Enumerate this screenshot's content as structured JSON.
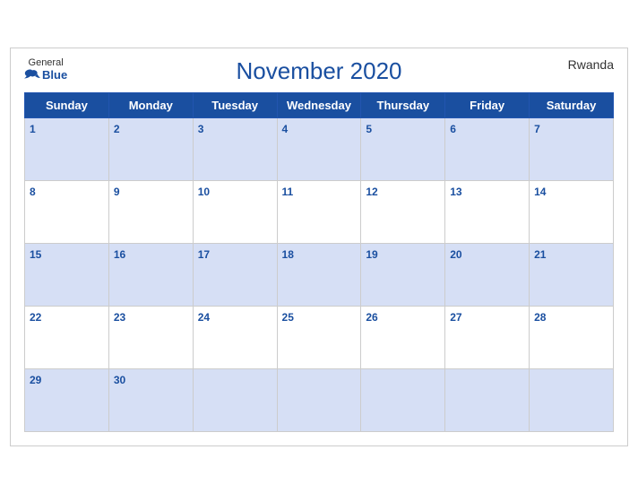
{
  "header": {
    "logo": {
      "general": "General",
      "blue": "Blue"
    },
    "title": "November 2020",
    "country": "Rwanda"
  },
  "weekdays": [
    "Sunday",
    "Monday",
    "Tuesday",
    "Wednesday",
    "Thursday",
    "Friday",
    "Saturday"
  ],
  "weeks": [
    [
      {
        "date": "1",
        "empty": false
      },
      {
        "date": "2",
        "empty": false
      },
      {
        "date": "3",
        "empty": false
      },
      {
        "date": "4",
        "empty": false
      },
      {
        "date": "5",
        "empty": false
      },
      {
        "date": "6",
        "empty": false
      },
      {
        "date": "7",
        "empty": false
      }
    ],
    [
      {
        "date": "8",
        "empty": false
      },
      {
        "date": "9",
        "empty": false
      },
      {
        "date": "10",
        "empty": false
      },
      {
        "date": "11",
        "empty": false
      },
      {
        "date": "12",
        "empty": false
      },
      {
        "date": "13",
        "empty": false
      },
      {
        "date": "14",
        "empty": false
      }
    ],
    [
      {
        "date": "15",
        "empty": false
      },
      {
        "date": "16",
        "empty": false
      },
      {
        "date": "17",
        "empty": false
      },
      {
        "date": "18",
        "empty": false
      },
      {
        "date": "19",
        "empty": false
      },
      {
        "date": "20",
        "empty": false
      },
      {
        "date": "21",
        "empty": false
      }
    ],
    [
      {
        "date": "22",
        "empty": false
      },
      {
        "date": "23",
        "empty": false
      },
      {
        "date": "24",
        "empty": false
      },
      {
        "date": "25",
        "empty": false
      },
      {
        "date": "26",
        "empty": false
      },
      {
        "date": "27",
        "empty": false
      },
      {
        "date": "28",
        "empty": false
      }
    ],
    [
      {
        "date": "29",
        "empty": false
      },
      {
        "date": "30",
        "empty": false
      },
      {
        "date": "",
        "empty": true
      },
      {
        "date": "",
        "empty": true
      },
      {
        "date": "",
        "empty": true
      },
      {
        "date": "",
        "empty": true
      },
      {
        "date": "",
        "empty": true
      }
    ]
  ],
  "colors": {
    "header_bg": "#1a4fa0",
    "row_odd_bg": "#d6dff5",
    "row_even_bg": "#ffffff",
    "day_number_color": "#1a4fa0",
    "title_color": "#1a4fa0"
  }
}
